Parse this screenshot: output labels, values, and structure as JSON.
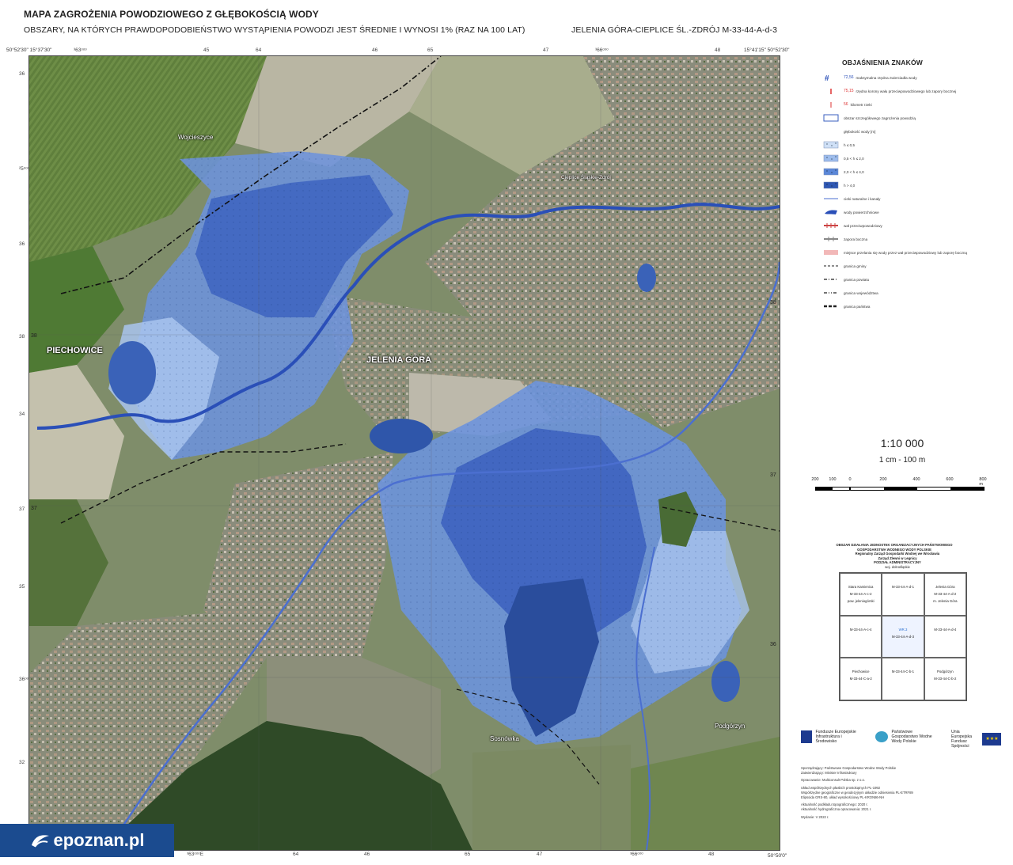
{
  "title": "MAPA ZAGROŻENIA POWODZIOWEGO Z GŁĘBOKOŚCIĄ WODY",
  "subtitle": "OBSZARY, NA KTÓRYCH PRAWDOPODOBIEŃSTWO WYSTĄPIENIA POWODZI JEST ŚREDNIE I WYNOSI 1% (RAZ NA 100 LAT)",
  "sheet_id": "JELENIA GÓRA-CIEPLICE ŚL.-ZDRÓJ M-33-44-A-d-3",
  "corners": {
    "top_left": "50°52'30\" 15°37'30\"",
    "top_right": "15°41'15\" 50°52'30\"",
    "bottom_left": "50°50'0\"",
    "bottom_right": "15°41'15\" 50°50'0\""
  },
  "top_ticks": [
    "³63ᵒᵒᵒ",
    "45",
    "64",
    "46",
    "65",
    "47",
    "³66ᵒᵒᵒ",
    "48"
  ],
  "bottom_ticks": [
    "³63ᵒᵒᵒE",
    "64",
    "46",
    "65",
    "47",
    "³66ᵒᵒᵒ",
    "48"
  ],
  "left_ticks": [
    "36",
    "²5ᵒᵒᵒ",
    "36",
    "38",
    "34",
    "37",
    "35",
    "36ᵒᵒ",
    "32"
  ],
  "grid_labels": [
    "38",
    "37",
    "38",
    "37",
    "36"
  ],
  "places": {
    "piechowice": "PIECHOWICE",
    "jelenia_gora": "JELENIA GÓRA",
    "wojcieszyce": "Wojcieszyce",
    "cieplice": "Cieplice Śląskie-Zdrój",
    "sosnowka": "Sosnówka",
    "podgorzyn": "Podgórzyn"
  },
  "legend": {
    "title": "OBJAŚNIENIA ZNAKÓW",
    "items": [
      {
        "label": "maksymalna rzędna zwierciadła wody",
        "value": "72,56",
        "symbol": "hash",
        "color": "#2a4fb8"
      },
      {
        "label": "rzędna korony wału przeciwpowodziowego lub zapory bocznej",
        "value": "75,15",
        "symbol": "dash-red",
        "color": "#d33"
      },
      {
        "label": "kilometr rzeki",
        "value": "56",
        "symbol": "km",
        "color": "#d33"
      },
      {
        "label": "obszar szczegółowego zagrożenia powodzią",
        "symbol": "box-outline",
        "color": "#3a5fbf"
      },
      {
        "label": "głębokość wody [m]",
        "symbol": "none",
        "color": ""
      },
      {
        "label": "h ≤ 0,5",
        "symbol": "fill",
        "color": "#cfe0f6"
      },
      {
        "label": "0,5 < h ≤ 2,0",
        "symbol": "fill",
        "color": "#9dbcec"
      },
      {
        "label": "2,0 < h ≤ 4,0",
        "symbol": "fill",
        "color": "#5b87d8"
      },
      {
        "label": "h > 4,0",
        "symbol": "fill",
        "color": "#2e57b3"
      },
      {
        "label": "cieki naturalne i kanały",
        "symbol": "line",
        "color": "#4b6fd0"
      },
      {
        "label": "wody powierzchniowe",
        "symbol": "water",
        "color": "#2a4fb8"
      },
      {
        "label": "wał przeciwpowodziowy",
        "symbol": "levee",
        "color": "#c44"
      },
      {
        "label": "zapora boczna",
        "symbol": "levee-gray",
        "color": "#888"
      },
      {
        "label": "miejsce przelania się wody przez wał przeciwpowodziowy lub zaporę boczną",
        "symbol": "pink",
        "color": "#f2b8b8"
      },
      {
        "label": "granica gminy",
        "symbol": "dash",
        "color": "#222"
      },
      {
        "label": "granica powiatu",
        "symbol": "dashdot",
        "color": "#222"
      },
      {
        "label": "granica województwa",
        "symbol": "dashdotdot",
        "color": "#222"
      },
      {
        "label": "granica państwa",
        "symbol": "state",
        "color": "#222"
      }
    ]
  },
  "scale": {
    "ratio": "1:10 000",
    "unit": "1 cm - 100 m",
    "bar_labels": [
      "200",
      "100",
      "0",
      "200",
      "400",
      "600",
      "800 m"
    ]
  },
  "admin": {
    "heading": "OBSZAR DZIAŁANIA JEDNOSTEK ORGANIZACYJNYCH PAŃSTWOWEGO GOSPODARSTWA WODNEGO WODY POLSKIE",
    "rzgw": "Regionalny Zarząd Gospodarki Wodnej we Wrocławiu",
    "zarzad": "Zarząd Zlewni w Legnicy",
    "podzial": "PODZIAŁ ADMINISTRACYJNY",
    "woj": "woj. dolnośląskie"
  },
  "index_cells": [
    {
      "lines": [
        "Stara Kamienica",
        "M-33-44-A-c-2",
        "pow. jeleniogórski"
      ]
    },
    {
      "lines": [
        "M-33-44-A-d-1"
      ]
    },
    {
      "lines": [
        "Jelenia Góra",
        "M-33-44-A-d-2",
        "m. Jelenia Góra"
      ]
    },
    {
      "lines": [
        "M-33-44-A-c-4"
      ]
    },
    {
      "lines": [
        "WR.3",
        "M-33-44-A-d-3"
      ]
    },
    {
      "lines": [
        "M-33-44-A-d-4"
      ]
    },
    {
      "lines": [
        "Piechowice",
        "M-33-44-C-a-2"
      ]
    },
    {
      "lines": [
        "M-33-44-C-b-1"
      ]
    },
    {
      "lines": [
        "Podgórzyn",
        "M-33-44-C-b-2"
      ]
    }
  ],
  "logos": {
    "fe": "Fundusze Europejskie Infrastruktura i Środowisko",
    "wp": "Państwowe Gospodarstwo Wodne Wody Polskie",
    "ue": "Unia Europejska Fundusz Spójności"
  },
  "credits": [
    "Sporządzający: Państwowe Gospodarstwo Wodne Wody Polskie",
    "Zatwierdzający: Minister Infrastruktury",
    "Opracowanie: Multiconsult Polska sp. z o.o.",
    "Układ współrzędnych płaskich prostokątnych PL-1992",
    "Współrzędne geograficzne w geodezyjnym układzie odniesienia PL-ETRF89",
    "Elipsoida GRS-80, układ wysokościowy PL-KRON86-NH",
    "Aktualność podkładu topograficznego: 2020 r.",
    "Aktualność hydrograficzna opracowania: 2021 r.",
    "Wydanie: V 2022 r."
  ],
  "watermark": "epoznan.pl",
  "colors": {
    "flood_shallow": "#a9c4ee",
    "flood_mid": "#6d93dc",
    "flood_deep": "#3d63bf",
    "flood_verydeep": "#2a4a9a",
    "water": "#2f56aa",
    "forest": "#2d4a26",
    "field": "#8fa167",
    "urban": "#9b9a90"
  }
}
